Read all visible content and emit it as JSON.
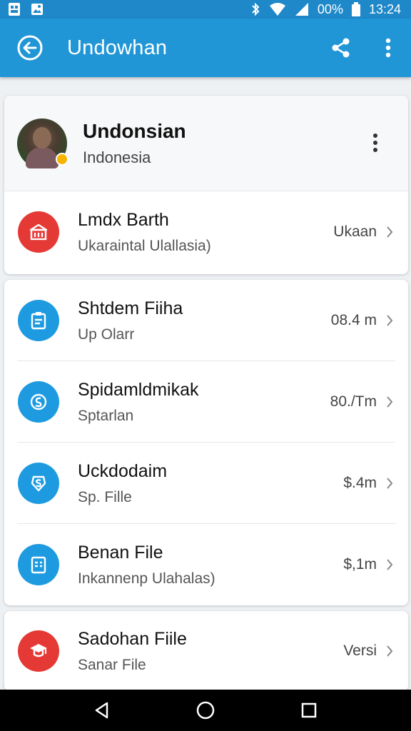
{
  "status_bar": {
    "battery": "00%",
    "time": "13:24",
    "icons": [
      "sim-icon",
      "image-icon",
      "bluetooth-icon",
      "wifi-icon",
      "signal-icon",
      "battery-icon"
    ]
  },
  "app_bar": {
    "title": "Undowhan",
    "color": "#2196d6",
    "icons": [
      "back-icon",
      "share-icon",
      "more-vert-icon"
    ]
  },
  "profile": {
    "name": "Undonsian",
    "subtitle": "Indonesia"
  },
  "primary_item": {
    "title": "Lmdx Barth",
    "subtitle": "Ukaraintal Ulallasia)",
    "meta": "Ukaan",
    "icon": "bank-icon",
    "icon_color": "#e53935"
  },
  "files": [
    {
      "title": "Shtdem Fiiha",
      "subtitle": "Up Olarr",
      "meta": "08.4 m",
      "icon": "clipboard-icon",
      "icon_color": "#1e9be0"
    },
    {
      "title": "Spidamldmikak",
      "subtitle": "Sptarlan",
      "meta": "80./Tm",
      "icon": "sync-icon",
      "icon_color": "#1e9be0"
    },
    {
      "title": "Uckdodaim",
      "subtitle": "Sp. Fille",
      "meta": "$.4m",
      "icon": "badge-s-icon",
      "icon_color": "#1e9be0"
    },
    {
      "title": "Benan File",
      "subtitle": "Inkannenp Ulahalas)",
      "meta": "$,1m",
      "icon": "document-icon",
      "icon_color": "#1e9be0"
    }
  ],
  "last_item": {
    "title": "Sadohan Fiile",
    "subtitle": "Sanar File",
    "meta": "Versi",
    "icon": "graduation-icon",
    "icon_color": "#e53935"
  },
  "nav_bar": {
    "icons": [
      "nav-back-icon",
      "home-icon",
      "recents-icon"
    ]
  }
}
